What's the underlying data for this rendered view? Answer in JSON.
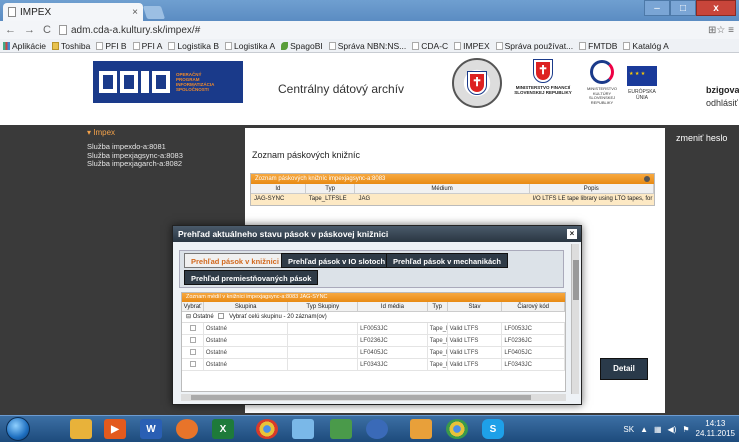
{
  "browser": {
    "tab_title": "IMPEX",
    "tab_close": "×",
    "address": "adm.cda-a.kultury.sk/impex/#",
    "nav_back": "←",
    "nav_forward": "→",
    "nav_reload": "C",
    "right_icons": "⊞☆ ≡",
    "window_controls": {
      "minimize": "–",
      "maximize": "□",
      "close": "x"
    }
  },
  "bookmarks": [
    {
      "label": "Aplikácie",
      "icon": "apps-icon"
    },
    {
      "label": "Toshiba",
      "icon": "folder-icon"
    },
    {
      "label": "PFI B",
      "icon": "page-icon"
    },
    {
      "label": "PFI A",
      "icon": "page-icon"
    },
    {
      "label": "Logistika B",
      "icon": "page-icon"
    },
    {
      "label": "Logistika A",
      "icon": "page-icon"
    },
    {
      "label": "SpagoBI",
      "icon": "leaf-icon"
    },
    {
      "label": "Správa NBN:NS...",
      "icon": "page-icon"
    },
    {
      "label": "CDA-C",
      "icon": "page-icon"
    },
    {
      "label": "IMPEX",
      "icon": "page-icon"
    },
    {
      "label": "Správa používat...",
      "icon": "page-icon"
    },
    {
      "label": "FMTDB",
      "icon": "page-icon"
    },
    {
      "label": "Katalóg A",
      "icon": "page-icon"
    }
  ],
  "header": {
    "logo_caption": "OPERAČNÝ PROGRAM INFORMATIZÁCIA SPOLOČNOSTI",
    "site_title": "Centrálny dátový archív",
    "ministry_finance": "MINISTERSTVO FINANCIÍ SLOVENSKEJ REPUBLIKY",
    "ministry_culture": "MINISTERSTVO KULTÚRY SLOVENSKEJ REPUBLIKY",
    "eu_caption": "EURÓPSKA ÚNIA",
    "user": "bzigova",
    "logout": "odhlásiť"
  },
  "sidebar": {
    "heading": "▾ Impex",
    "items": [
      "Služba impexdo-a:8081",
      "Služba impexjagsync-a:8083",
      "Služba impexjagarch-a:8082"
    ],
    "change_password": "zmeniť heslo"
  },
  "main": {
    "title": "Zoznam páskových knižníc",
    "grid_title": "Zoznam páskových knižníc impexjagsync-a:8083",
    "columns": [
      "Id",
      "Typ",
      "Médium",
      "Popis"
    ],
    "rows": [
      {
        "id": "JAG-SYNC",
        "typ": "Tape_LTFSLE",
        "medium": "JAG",
        "popis": "I/O LTFS LE tape library using LTO tapes, for communica"
      }
    ],
    "detail_button": "Detail"
  },
  "modal": {
    "title": "Prehľad aktuálneho stavu pások v páskovej knižnici",
    "close": "×",
    "tabs": [
      "Prehľad pások v knižnici",
      "Prehľad pások v IO slotoch",
      "Prehľad pások v mechanikách",
      "Prehľad premiestňovaných pások"
    ],
    "active_tab": 0,
    "grid_title": "Zoznam médií v knižnici impexjagsync-a:8083 JAG-SYNC",
    "columns": [
      "Vybrať",
      "Skupina",
      "Typ Skupiny",
      "Id média",
      "Typ",
      "Stav",
      "Čiarový kód"
    ],
    "group_row": {
      "prefix": "⊟ Ostatné",
      "label": "Vybrať celú skupinu - 20 záznam(ov)"
    },
    "rows": [
      {
        "skupina": "Ostatné",
        "typ_skupiny": "",
        "id_media": "LF0053JC",
        "typ": "Tape_L",
        "stav": "Valid LTFS",
        "kod": "LF0053JC"
      },
      {
        "skupina": "Ostatné",
        "typ_skupiny": "",
        "id_media": "LF0236JC",
        "typ": "Tape_L",
        "stav": "Valid LTFS",
        "kod": "LF0236JC"
      },
      {
        "skupina": "Ostatné",
        "typ_skupiny": "",
        "id_media": "LF0405JC",
        "typ": "Tape_L",
        "stav": "Valid LTFS",
        "kod": "LF0405JC"
      },
      {
        "skupina": "Ostatné",
        "typ_skupiny": "",
        "id_media": "LF0343JC",
        "typ": "Tape_L",
        "stav": "Valid LTFS",
        "kod": "LF0343JC"
      }
    ]
  },
  "taskbar": {
    "apps": [
      "explorer",
      "media",
      "word",
      "firefox",
      "excel",
      "chrome",
      "photos",
      "network",
      "lync",
      "chrome2",
      "skype"
    ],
    "tray_lang": "SK",
    "time": "14:13",
    "date": "24.11.2015"
  },
  "colors": {
    "orange": "#f7a840",
    "dark_panel": "#3a3a3a",
    "opis_blue": "#1a3a8a"
  }
}
